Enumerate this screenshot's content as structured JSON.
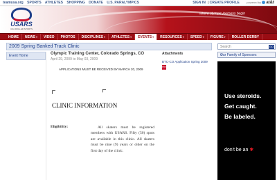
{
  "topbar": {
    "links": [
      "teamusa.org",
      "SPORTS",
      "ATHLETES",
      "SHOPPING",
      "DONATE",
      "U.S. PARALYMPICS"
    ],
    "sign_in": "SIGN IN",
    "separator": "|",
    "create_profile": "CREATE PROFILE",
    "powered_by": "powered by",
    "sponsor": "at&t"
  },
  "banner": {
    "tagline": "where olympic journeys begin",
    "logo_text": "USARS",
    "logo_sub": "USA ROLLER SPORTS"
  },
  "nav": {
    "items": [
      {
        "label": "HOME",
        "dropdown": false
      },
      {
        "label": "NEWS",
        "dropdown": true
      },
      {
        "label": "VIDEO",
        "dropdown": false
      },
      {
        "label": "PHOTOS",
        "dropdown": false
      },
      {
        "label": "DISCIPLINES",
        "dropdown": true
      },
      {
        "label": "ATHLETES",
        "dropdown": true
      },
      {
        "label": "EVENTS",
        "dropdown": true
      },
      {
        "label": "RESOURCES",
        "dropdown": true
      },
      {
        "label": "SPEED",
        "dropdown": true
      },
      {
        "label": "FIGURE",
        "dropdown": true
      },
      {
        "label": "ROLLER DERBY",
        "dropdown": false
      }
    ],
    "active": "EVENTS",
    "arrow": "▾"
  },
  "page": {
    "title": "2009 Spring Banked Track Clinic"
  },
  "submenu": {
    "items": [
      "Event Home"
    ]
  },
  "event": {
    "location": "Olympic Training Center, Colorado Springs, CO",
    "dates": "April 29, 2009 to May 03, 2009",
    "deadline": "APPLICATIONS MUST BE RECEIVED BY MARCH 20, 2009",
    "section_heading": "CLINIC INFORMATION",
    "eligibility_label": "Eligibility:",
    "eligibility_text": "All skaters must be registered members with USARS. Fifty (50) spots are available in this clinic. All skaters must be nine (9) years or older on the first day of the clinic."
  },
  "attachments": {
    "heading": "Attachments",
    "items": [
      {
        "label": "BTC-CO Application Spring 2009",
        "icon": "pdf-icon"
      }
    ]
  },
  "sidebar": {
    "search_placeholder": "Search",
    "search_button": "GO",
    "sponsors_label": "Our Family of Sponsors",
    "sponsors_arrow": "»"
  },
  "ad": {
    "line1": "Use steroids.",
    "line2": "Get caught.",
    "line3": "Be labeled.",
    "line4": "don't be an",
    "star": "✱"
  },
  "colors": {
    "brand_red": "#9a0d14",
    "brand_blue": "#1f3f8a",
    "title_bg": "#dfe6f3"
  }
}
